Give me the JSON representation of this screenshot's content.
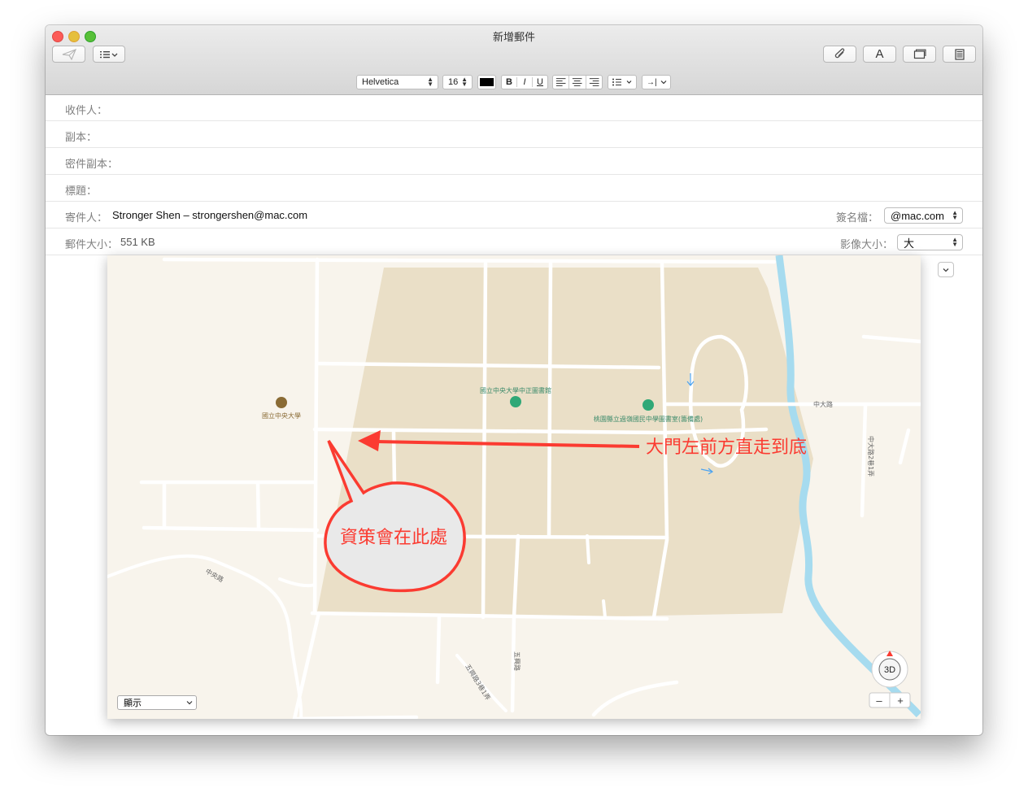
{
  "window": {
    "title": "新增郵件"
  },
  "format_bar": {
    "font": "Helvetica",
    "size": "16",
    "bold": "B",
    "italic": "I",
    "underline": "U",
    "indent": "→|"
  },
  "toolbar": {
    "font_button": "A"
  },
  "headers": {
    "to_label": "收件人：",
    "cc_label": "副本：",
    "bcc_label": "密件副本：",
    "subject_label": "標題：",
    "from_label": "寄件人：",
    "from_value": "Stronger Shen – strongershen@mac.com",
    "signature_label": "簽名檔：",
    "signature_value": "@mac.com",
    "size_label": "郵件大小：",
    "size_value": "551 KB",
    "image_size_label": "影像大小：",
    "image_size_value": "大"
  },
  "map": {
    "labels": {
      "library": "國立中央大學中正圖書館",
      "university": "國立中央大學",
      "school": "桃園縣立過嶺國民中學圖書室(籌備處)",
      "zhongda_road": "中大路",
      "zhongda_road_lane": "中大路2巷1弄",
      "zhongyang_road": "中央路",
      "wuxing_road": "五興路",
      "wuxing_lane": "五興路3巷1弄"
    },
    "annotation_arrow_text": "大門左前方直走到底",
    "annotation_bubble_text": "資策會在此處",
    "display_select": "顯示",
    "btn_3d": "3D",
    "zoom_out": "–",
    "zoom_in": "+",
    "colors": {
      "land": "#f8f4ec",
      "campus": "#eadfc7",
      "river": "#a6dbef",
      "annotation": "#fb3b31"
    }
  }
}
